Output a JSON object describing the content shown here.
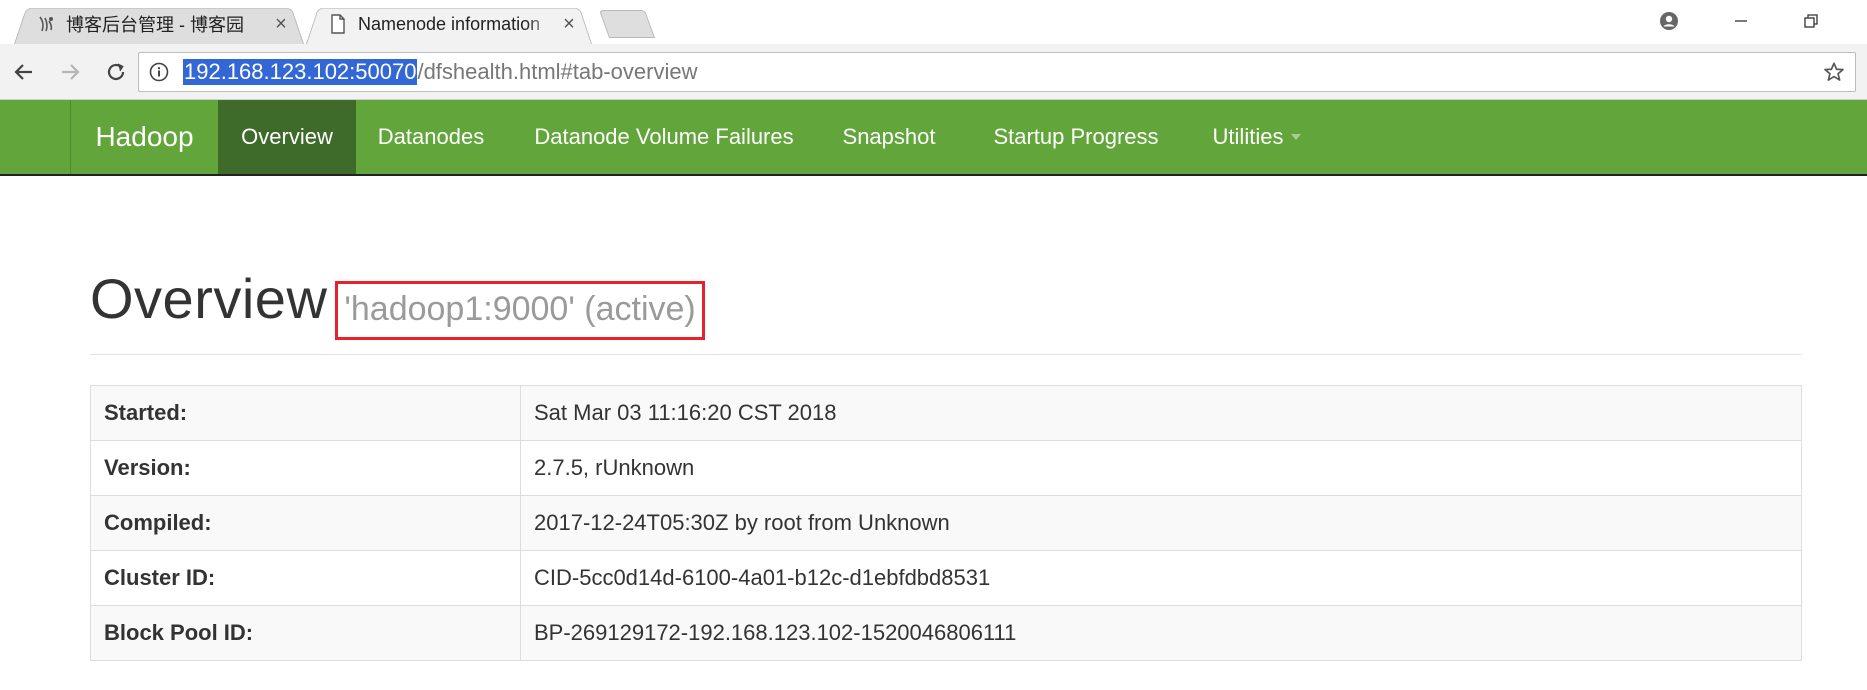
{
  "browser": {
    "tabs": [
      {
        "title": "博客后台管理 - 博客园",
        "active": false,
        "icon": "cnblogs-icon"
      },
      {
        "title": "Namenode information",
        "active": true,
        "icon": "page-icon"
      }
    ],
    "close_glyph": "×",
    "address": {
      "host": "192.168.123.102:50070",
      "path": "/dfshealth.html#tab-overview"
    }
  },
  "navbar": {
    "brand": "Hadoop",
    "items": [
      {
        "label": "Overview",
        "active": true
      },
      {
        "label": "Datanodes",
        "active": false
      },
      {
        "label": "Datanode Volume Failures",
        "active": false
      },
      {
        "label": "Snapshot",
        "active": false
      },
      {
        "label": "Startup Progress",
        "active": false
      },
      {
        "label": "Utilities",
        "active": false,
        "dropdown": true
      }
    ],
    "colors": {
      "bar": "#62a53a",
      "active": "#3f6b2a"
    }
  },
  "overview": {
    "title": "Overview",
    "subtitle": "'hadoop1:9000' (active)",
    "highlight_color": "#e8222d",
    "rows": [
      {
        "key": "Started:",
        "value": "Sat Mar 03 11:16:20 CST 2018"
      },
      {
        "key": "Version:",
        "value": "2.7.5, rUnknown"
      },
      {
        "key": "Compiled:",
        "value": "2017-12-24T05:30Z by root from Unknown"
      },
      {
        "key": "Cluster ID:",
        "value": "CID-5cc0d14d-6100-4a01-b12c-d1ebfdbd8531"
      },
      {
        "key": "Block Pool ID:",
        "value": "BP-269129172-192.168.123.102-1520046806111"
      }
    ]
  }
}
